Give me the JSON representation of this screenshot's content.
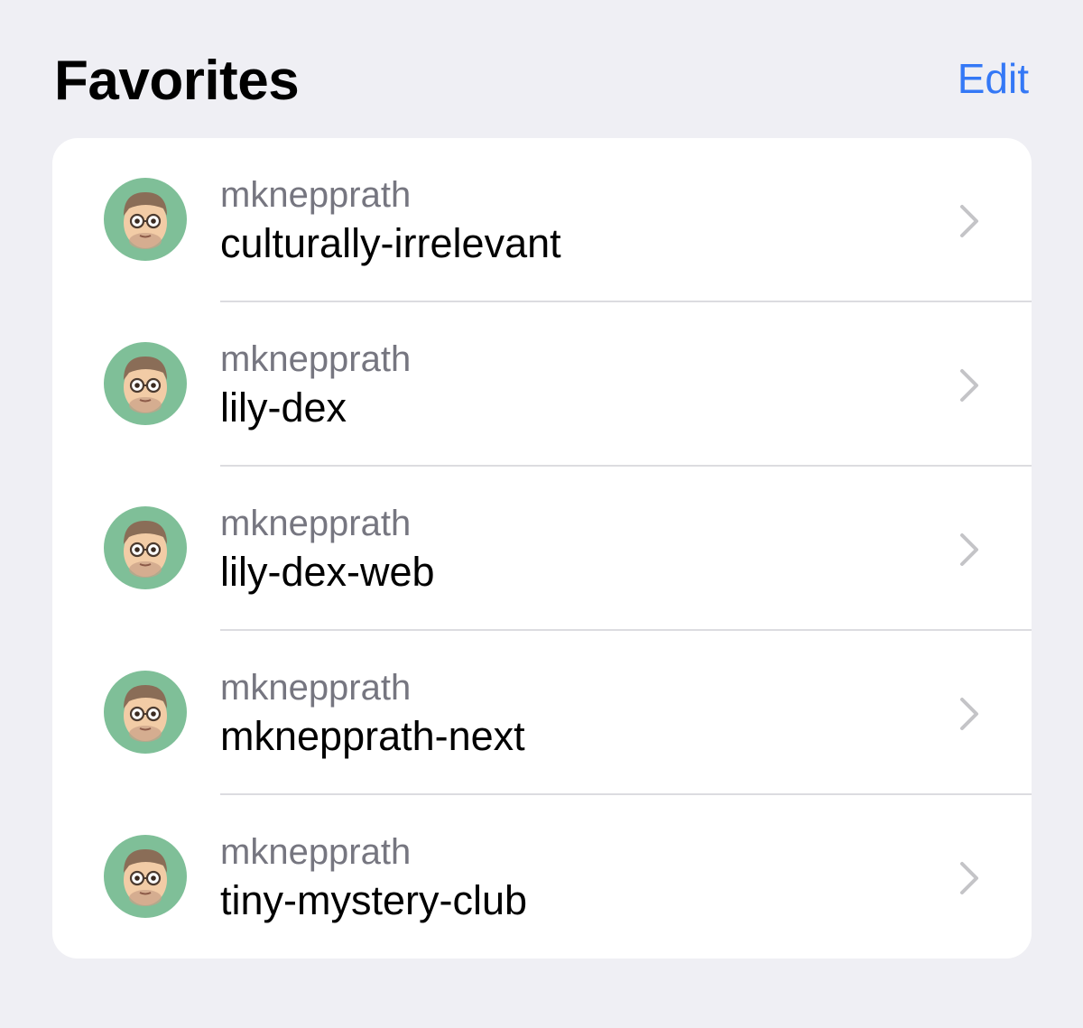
{
  "header": {
    "title": "Favorites",
    "edit_label": "Edit"
  },
  "favorites": [
    {
      "owner": "mknepprath",
      "repo": "culturally-irrelevant"
    },
    {
      "owner": "mknepprath",
      "repo": "lily-dex"
    },
    {
      "owner": "mknepprath",
      "repo": "lily-dex-web"
    },
    {
      "owner": "mknepprath",
      "repo": "mknepprath-next"
    },
    {
      "owner": "mknepprath",
      "repo": "tiny-mystery-club"
    }
  ],
  "colors": {
    "accent": "#3478f6",
    "background": "#efeff4",
    "secondary_text": "#767680",
    "avatar_bg": "#7fbf98"
  },
  "icons": {
    "avatar": "memoji-avatar-icon",
    "disclosure": "chevron-right-icon"
  }
}
